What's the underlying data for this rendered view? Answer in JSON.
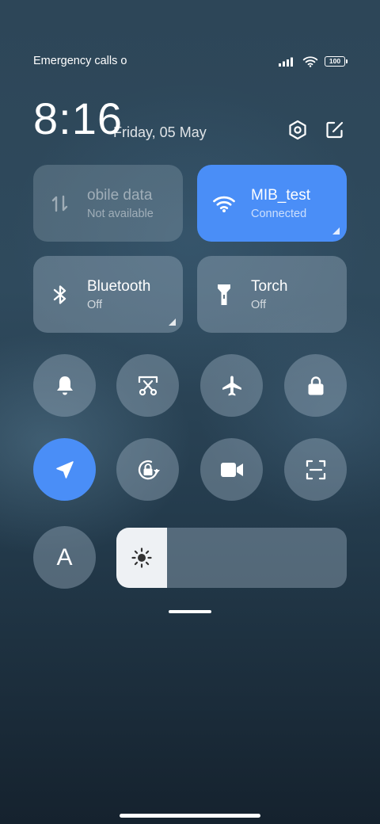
{
  "status_bar": {
    "carrier_text": "Emergency calls o",
    "battery_level": "100"
  },
  "header": {
    "time": "8:16",
    "date": "Friday, 05 May"
  },
  "tiles": {
    "mobile_data": {
      "title": "obile data",
      "subtitle": "Not available",
      "state": "disabled"
    },
    "wifi": {
      "title": "MIB_test",
      "subtitle": "Connected",
      "state": "on"
    },
    "bluetooth": {
      "title": "Bluetooth",
      "subtitle": "Off",
      "state": "off"
    },
    "torch": {
      "title": "Torch",
      "subtitle": "Off",
      "state": "off"
    }
  },
  "toggles": [
    {
      "name": "ringer",
      "icon": "bell-icon",
      "state": "off"
    },
    {
      "name": "screenshot",
      "icon": "scissors-icon",
      "state": "off"
    },
    {
      "name": "airplane-mode",
      "icon": "airplane-icon",
      "state": "off"
    },
    {
      "name": "lock-screen",
      "icon": "lock-icon",
      "state": "off"
    },
    {
      "name": "location",
      "icon": "location-arrow-icon",
      "state": "on"
    },
    {
      "name": "rotation-lock",
      "icon": "rotation-lock-icon",
      "state": "off"
    },
    {
      "name": "screen-recorder",
      "icon": "video-camera-icon",
      "state": "off"
    },
    {
      "name": "scanner",
      "icon": "scan-icon",
      "state": "off"
    }
  ],
  "font_toggle": {
    "label": "A"
  },
  "brightness": {
    "level_percent": 22
  },
  "colors": {
    "accent": "#4a8ef7",
    "tile_background": "#8fa3b2"
  }
}
